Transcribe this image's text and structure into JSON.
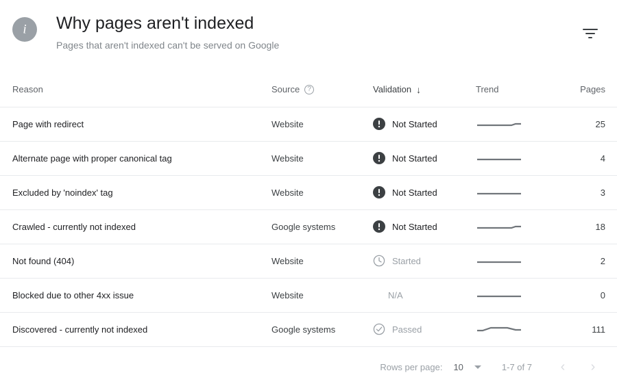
{
  "header": {
    "info_icon": "info-circle-icon",
    "title": "Why pages aren't indexed",
    "subtitle": "Pages that aren't indexed can't be served on Google",
    "filter_icon": "filter-icon"
  },
  "table": {
    "columns": [
      {
        "key": "reason",
        "label": "Reason"
      },
      {
        "key": "source",
        "label": "Source",
        "help_icon": "help-circle-icon"
      },
      {
        "key": "validation",
        "label": "Validation",
        "sorted": true,
        "sort_icon": "arrow-down-icon"
      },
      {
        "key": "trend",
        "label": "Trend"
      },
      {
        "key": "pages",
        "label": "Pages"
      }
    ],
    "rows": [
      {
        "reason": "Page with redirect",
        "source": "Website",
        "validation": "Not Started",
        "validation_state": "not-started",
        "validation_icon": "exclamation-circle-icon",
        "trend": "flat-uptick",
        "pages": "25"
      },
      {
        "reason": "Alternate page with proper canonical tag",
        "source": "Website",
        "validation": "Not Started",
        "validation_state": "not-started",
        "validation_icon": "exclamation-circle-icon",
        "trend": "flat",
        "pages": "4"
      },
      {
        "reason": "Excluded by 'noindex' tag",
        "source": "Website",
        "validation": "Not Started",
        "validation_state": "not-started",
        "validation_icon": "exclamation-circle-icon",
        "trend": "flat",
        "pages": "3"
      },
      {
        "reason": "Crawled - currently not indexed",
        "source": "Google systems",
        "validation": "Not Started",
        "validation_state": "not-started",
        "validation_icon": "exclamation-circle-icon",
        "trend": "flat-uptick",
        "pages": "18"
      },
      {
        "reason": "Not found (404)",
        "source": "Website",
        "validation": "Started",
        "validation_state": "started",
        "validation_icon": "clock-icon",
        "trend": "flat",
        "pages": "2"
      },
      {
        "reason": "Blocked due to other 4xx issue",
        "source": "Website",
        "validation": "N/A",
        "validation_state": "na",
        "validation_icon": "",
        "trend": "flat",
        "pages": "0"
      },
      {
        "reason": "Discovered - currently not indexed",
        "source": "Google systems",
        "validation": "Passed",
        "validation_state": "passed",
        "validation_icon": "check-circle-icon",
        "trend": "hump",
        "pages": "111"
      }
    ]
  },
  "footer": {
    "rows_per_page_label": "Rows per page:",
    "rows_per_page_value": "10",
    "caret_icon": "chevron-down-icon",
    "range_label": "1-7 of 7",
    "prev_icon": "chevron-left-icon",
    "prev_glyph": "‹",
    "next_icon": "chevron-right-icon",
    "next_glyph": "›"
  },
  "colors": {
    "text_primary": "#202124",
    "text_secondary": "#5f6368",
    "text_muted": "#9aa0a6",
    "divider": "#e8eaed",
    "status_dark": "#3c4043",
    "info_circle": "#9aa0a6",
    "trend_line": "#70757a"
  }
}
